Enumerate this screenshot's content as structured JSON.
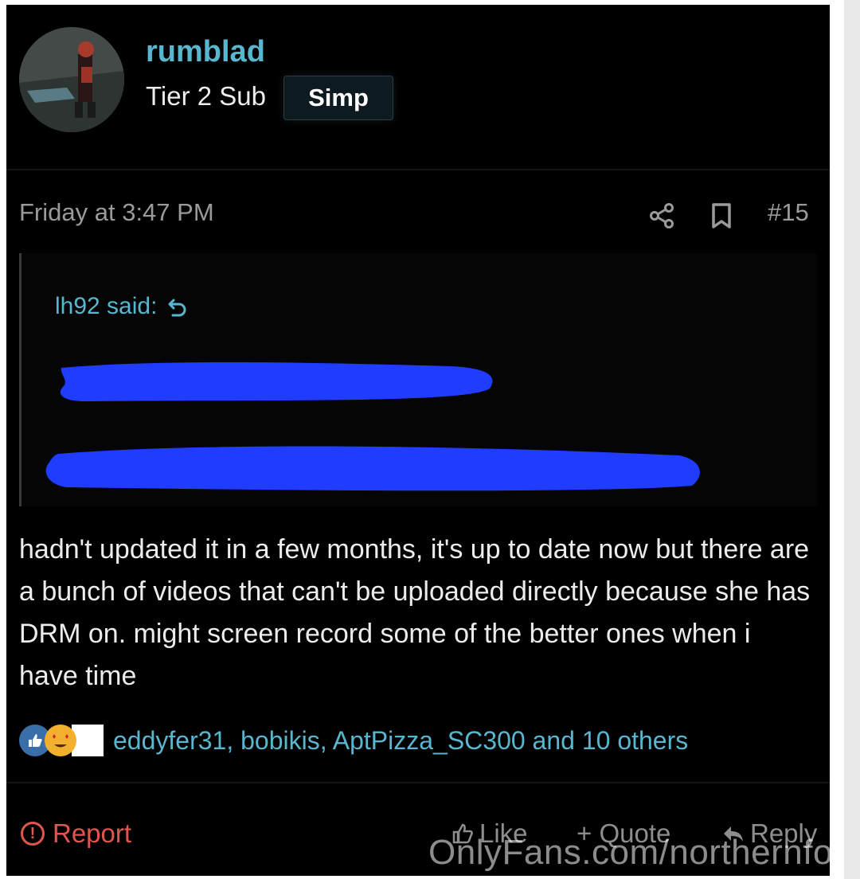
{
  "post": {
    "author": "rumblad",
    "tier": "Tier 2 Sub",
    "badge": "Simp",
    "timestamp": "Friday at 3:47 PM",
    "post_number": "#15"
  },
  "quote": {
    "author_said": "lh92 said:"
  },
  "body": "hadn't updated it in a few months, it's up to date now but there are a bunch of videos that can't be uploaded directly because she has DRM on. might screen record some of the better ones when i have time",
  "reactions": {
    "names": "eddyfer31, bobikis, AptPizza_SC300 and 10 others"
  },
  "actions": {
    "report": "Report",
    "like": "Like",
    "quote": "+ Quote",
    "reply": "Reply"
  },
  "watermark": "OnlyFans.com/northernfoxx",
  "colors": {
    "accent": "#58b6cf",
    "report": "#e0564e",
    "redaction": "#1f3cff"
  }
}
